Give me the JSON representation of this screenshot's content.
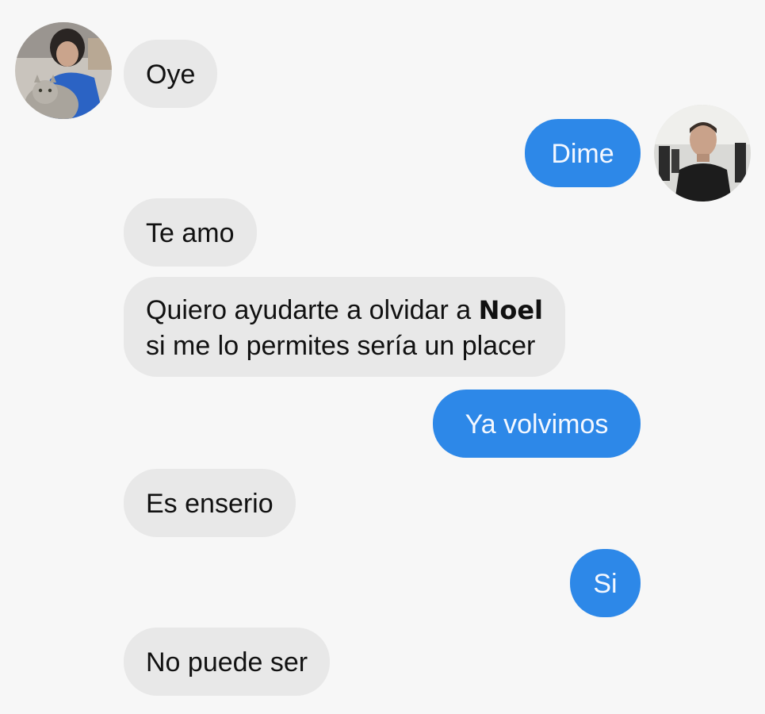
{
  "conversation": {
    "messages": [
      {
        "side": "received",
        "text": "Oye"
      },
      {
        "side": "sent",
        "text": "Dime"
      },
      {
        "side": "received",
        "text": "Te amo"
      },
      {
        "side": "received",
        "line1_prefix": "Quiero ayudarte a olvidar a ",
        "line1_name": "Noel",
        "line2": "si me lo permites sería un placer"
      },
      {
        "side": "sent",
        "text": "Ya volvimos"
      },
      {
        "side": "received",
        "text": "Es enserio"
      },
      {
        "side": "sent",
        "text": "Si"
      },
      {
        "side": "received",
        "text": "No puede ser"
      }
    ]
  },
  "colors": {
    "background": "#f7f7f7",
    "received_bubble": "#e8e8e8",
    "sent_bubble": "#2d88e8"
  },
  "avatars": {
    "contact": "person-with-cat-photo",
    "self": "man-in-black-photo"
  }
}
